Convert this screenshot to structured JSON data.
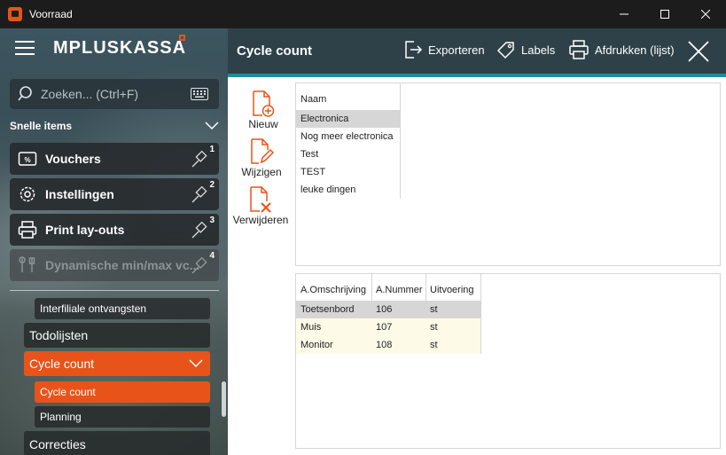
{
  "window": {
    "title": "Voorraad"
  },
  "sidebar": {
    "logo": "MPLUSKASSA",
    "search_placeholder": "Zoeken... (Ctrl+F)",
    "quick_title": "Snelle items",
    "quick_items": [
      {
        "label": "Vouchers",
        "num": "1"
      },
      {
        "label": "Instellingen",
        "num": "2"
      },
      {
        "label": "Print lay-outs",
        "num": "3"
      },
      {
        "label": "Dynamische min/max vc...",
        "num": "4"
      }
    ],
    "nav": {
      "interfiliale": "Interfiliale ontvangsten",
      "todolijsten": "Todolijsten",
      "cycle_count": "Cycle count",
      "cycle_count_sub": "Cycle count",
      "planning": "Planning",
      "correcties": "Correcties"
    }
  },
  "header": {
    "title": "Cycle count",
    "export_label": "Exporteren",
    "labels_label": "Labels",
    "print_label": "Afdrukken (lijst)"
  },
  "actions": {
    "new": "Nieuw",
    "edit": "Wijzigen",
    "delete": "Verwijderen"
  },
  "top_grid": {
    "column": "Naam",
    "rows": [
      "Electronica",
      "Nog meer electronica",
      "Test",
      "TEST",
      "leuke dingen"
    ]
  },
  "bottom_grid": {
    "columns": [
      "A.Omschrijving",
      "A.Nummer",
      "Uitvoering"
    ],
    "rows": [
      [
        "Toetsenbord",
        "106",
        "st"
      ],
      [
        "Muis",
        "107",
        "st"
      ],
      [
        "Monitor",
        "108",
        "st"
      ]
    ]
  },
  "colors": {
    "accent": "#e8531a",
    "header": "#2f4148",
    "teal": "#1e8f97"
  }
}
